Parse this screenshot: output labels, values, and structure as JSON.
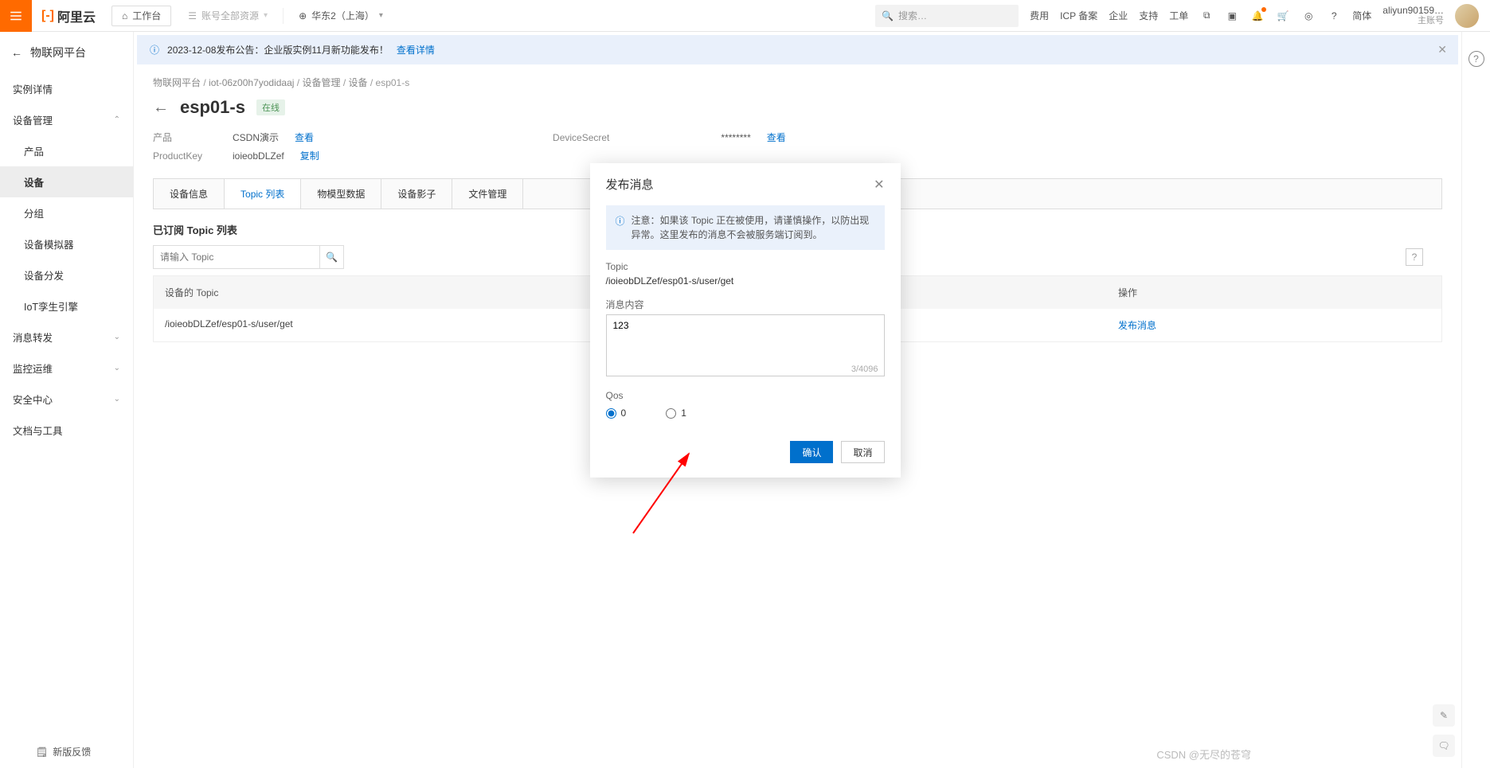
{
  "header": {
    "brand_cn": "阿里云",
    "workspace_label": "工作台",
    "resource_label": "账号全部资源",
    "region_label": "华东2（上海）",
    "search_placeholder": "搜索…",
    "links": {
      "fee": "费用",
      "icp": "ICP 备案",
      "enterprise": "企业",
      "support": "支持",
      "ticket": "工单",
      "lang": "简体"
    },
    "user_name": "aliyun90159…",
    "user_type": "主账号"
  },
  "sidebar": {
    "title": "物联网平台",
    "items": [
      {
        "label": "实例详情"
      },
      {
        "label": "设备管理",
        "expanded": true
      },
      {
        "label": "产品",
        "sub": true
      },
      {
        "label": "设备",
        "sub": true,
        "active": true
      },
      {
        "label": "分组",
        "sub": true
      },
      {
        "label": "设备模拟器",
        "sub": true
      },
      {
        "label": "设备分发",
        "sub": true
      },
      {
        "label": "IoT孪生引擎",
        "sub": true
      },
      {
        "label": "消息转发"
      },
      {
        "label": "监控运维"
      },
      {
        "label": "安全中心"
      },
      {
        "label": "文档与工具"
      }
    ],
    "footer": "新版反馈"
  },
  "banner": {
    "text": "2023-12-08发布公告：企业版实例11月新功能发布！",
    "link": "查看详情"
  },
  "crumb": [
    "物联网平台",
    "iot-06z00h7yodidaaj",
    "设备管理",
    "设备",
    "esp01-s"
  ],
  "page": {
    "title": "esp01-s",
    "status": "在线",
    "row1_k": "产品",
    "row1_v": "CSDN演示",
    "row1_link": "查看",
    "row1_k2": "DeviceSecret",
    "row1_v2": "********",
    "row1_link2": "查看",
    "row2_k": "ProductKey",
    "row2_v": "ioieobDLZef",
    "row2_link": "复制"
  },
  "tabs": [
    "设备信息",
    "Topic 列表",
    "物模型数据",
    "设备影子",
    "文件管理"
  ],
  "active_tab": 1,
  "section_title": "已订阅 Topic 列表",
  "search_placeholder": "请输入 Topic",
  "table": {
    "cols": [
      "设备的 Topic",
      "操作"
    ],
    "rows": [
      {
        "topic": "/ioieobDLZef/esp01-s/user/get",
        "op": "发布消息"
      }
    ]
  },
  "modal": {
    "title": "发布消息",
    "note": "注意：如果该 Topic 正在被使用，请谨慎操作，以防出现异常。这里发布的消息不会被服务端订阅到。",
    "topic_label": "Topic",
    "topic_value": "/ioieobDLZef/esp01-s/user/get",
    "content_label": "消息内容",
    "content_value": "123",
    "counter": "3/4096",
    "qos_label": "Qos",
    "qos_options": [
      "0",
      "1"
    ],
    "qos_selected": "0",
    "ok": "确认",
    "cancel": "取消"
  },
  "watermark": "CSDN @无尽的苍穹"
}
